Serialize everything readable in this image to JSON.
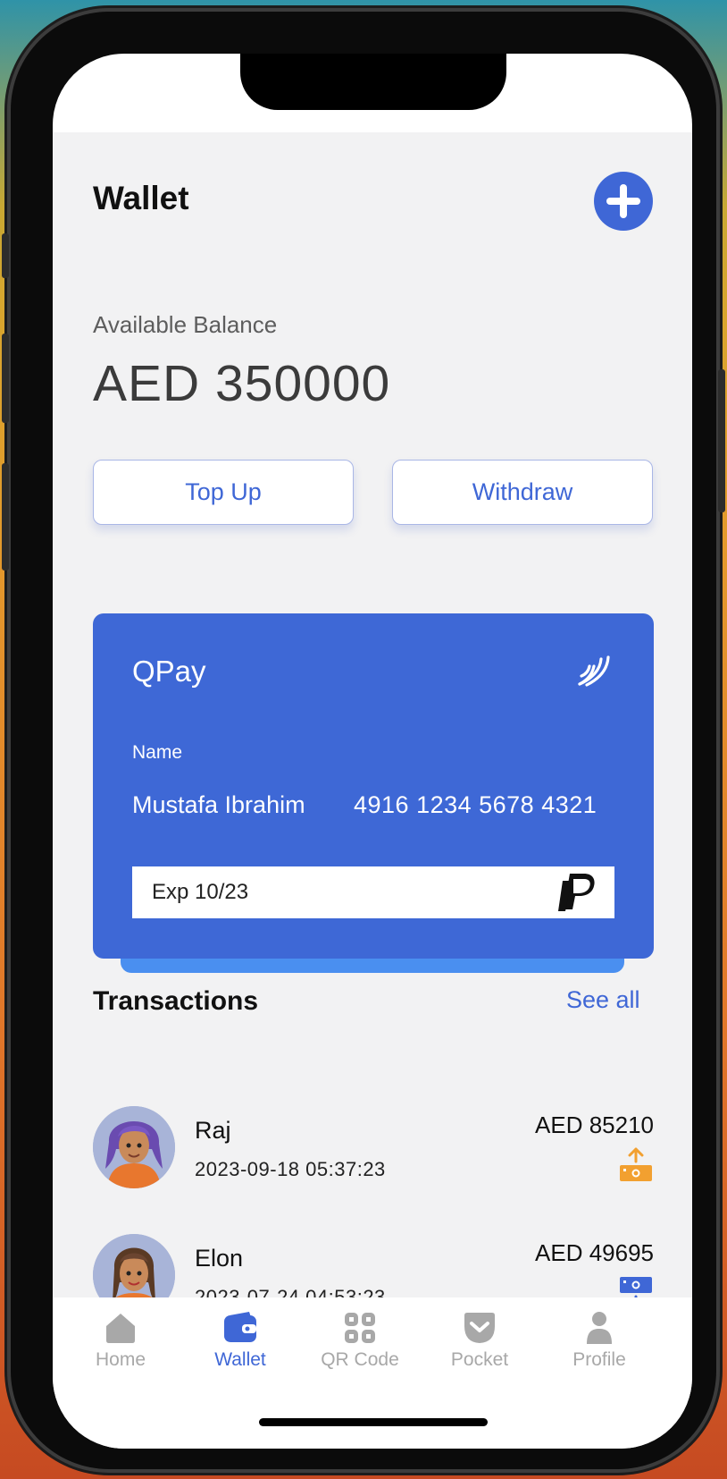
{
  "header": {
    "title": "Wallet",
    "add_icon": "plus-circle-icon"
  },
  "balance": {
    "label": "Available Balance",
    "value": "AED 350000"
  },
  "actions": {
    "top_up": "Top Up",
    "withdraw": "Withdraw"
  },
  "card": {
    "brand": "QPay",
    "contactless_icon": "contactless-icon",
    "name_label": "Name",
    "holder": "Mustafa Ibrahim",
    "number": "4916 1234 5678 4321",
    "expiry": "Exp 10/23",
    "network_icon": "paypal-icon"
  },
  "transactions": {
    "title": "Transactions",
    "see_all": "See all",
    "items": [
      {
        "name": "Raj",
        "date": "2023-09-18 05:37:23",
        "amount": "AED 85210",
        "icon": "cash-out-icon"
      },
      {
        "name": "Elon",
        "date": "2023-07-24 04:53:23",
        "amount": "AED 49695",
        "icon": "cash-in-icon"
      }
    ]
  },
  "tabbar": {
    "items": [
      {
        "label": "Home",
        "icon": "home-icon",
        "active": false
      },
      {
        "label": "Wallet",
        "icon": "wallet-icon",
        "active": true
      },
      {
        "label": "QR Code",
        "icon": "qr-code-icon",
        "active": false
      },
      {
        "label": "Pocket",
        "icon": "pocket-icon",
        "active": false
      },
      {
        "label": "Profile",
        "icon": "profile-icon",
        "active": false
      }
    ]
  },
  "colors": {
    "accent": "#3f67d6",
    "card": "#3e68d6",
    "orange": "#f2a030",
    "light_blue": "#4a8ff0"
  }
}
